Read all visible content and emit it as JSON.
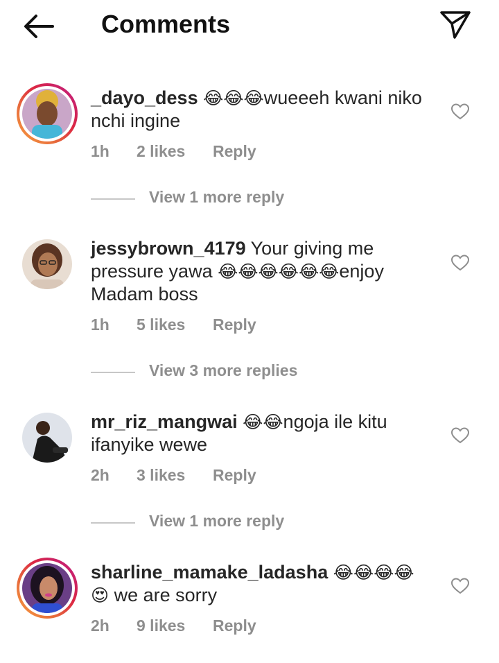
{
  "header": {
    "title": "Comments"
  },
  "comments": [
    {
      "username": "_dayo_dess",
      "emoji_before": "😂😂😂",
      "text": "wueeeh kwani niko nchi ingine",
      "time": "1h",
      "likes": "2 likes",
      "reply": "Reply",
      "view_replies": "View 1 more reply",
      "story_ring": true
    },
    {
      "username": "jessybrown_4179",
      "text_a": "Your giving me pressure yawa",
      "emoji_mid": "😂😂😂😂😂😂",
      "text_b": "enjoy Madam boss",
      "time": "1h",
      "likes": "5 likes",
      "reply": "Reply",
      "view_replies": "View 3 more replies",
      "story_ring": false
    },
    {
      "username": "mr_riz_mangwai",
      "emoji_before": "😂😂",
      "text": "ngoja ile kitu ifanyike wewe",
      "time": "2h",
      "likes": "3 likes",
      "reply": "Reply",
      "view_replies": "View 1 more reply",
      "story_ring": false
    },
    {
      "username": "sharline_mamake_ladasha",
      "emoji_before": "😂😂😂😂",
      "emoji_line2": "😍",
      "text": "we are sorry",
      "time": "2h",
      "likes": "9 likes",
      "reply": "Reply",
      "story_ring": true
    }
  ],
  "colors": {
    "text": "#262626",
    "meta": "#8e8e8e",
    "divider": "#c7c7c7"
  },
  "icons": {
    "back": "arrow-left-icon",
    "send": "paper-plane-icon",
    "like": "heart-outline-icon"
  }
}
